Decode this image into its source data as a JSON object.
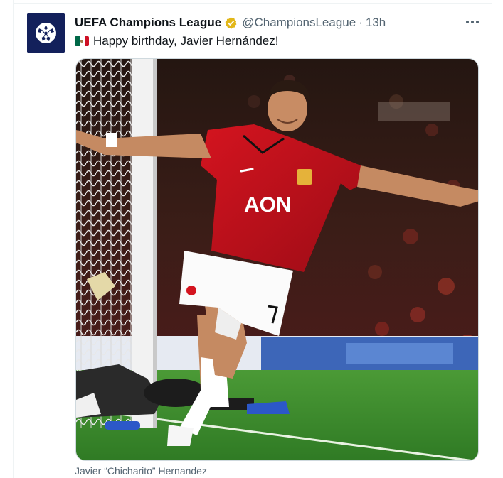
{
  "tweet": {
    "author_name": "UEFA Champions League",
    "handle": "@ChampionsLeague",
    "separator": "·",
    "time": "13h",
    "text": "Happy birthday, Javier Hernández!",
    "media_caption": "Javier “Chicharito” Hernandez",
    "shirt_text": "AON"
  },
  "icons": {
    "avatar": "champions-league-starball-logo",
    "verified": "gold-verified-badge-icon",
    "more": "more-horizontal-icon",
    "flag": "mexico-flag-emoji"
  },
  "colors": {
    "avatar_bg": "#13205b",
    "verified_gold": "#e2b719",
    "text_primary": "#0f1419",
    "text_secondary": "#536471",
    "jersey_red": "#c8102e",
    "pitch_green": "#3f8f2e"
  }
}
